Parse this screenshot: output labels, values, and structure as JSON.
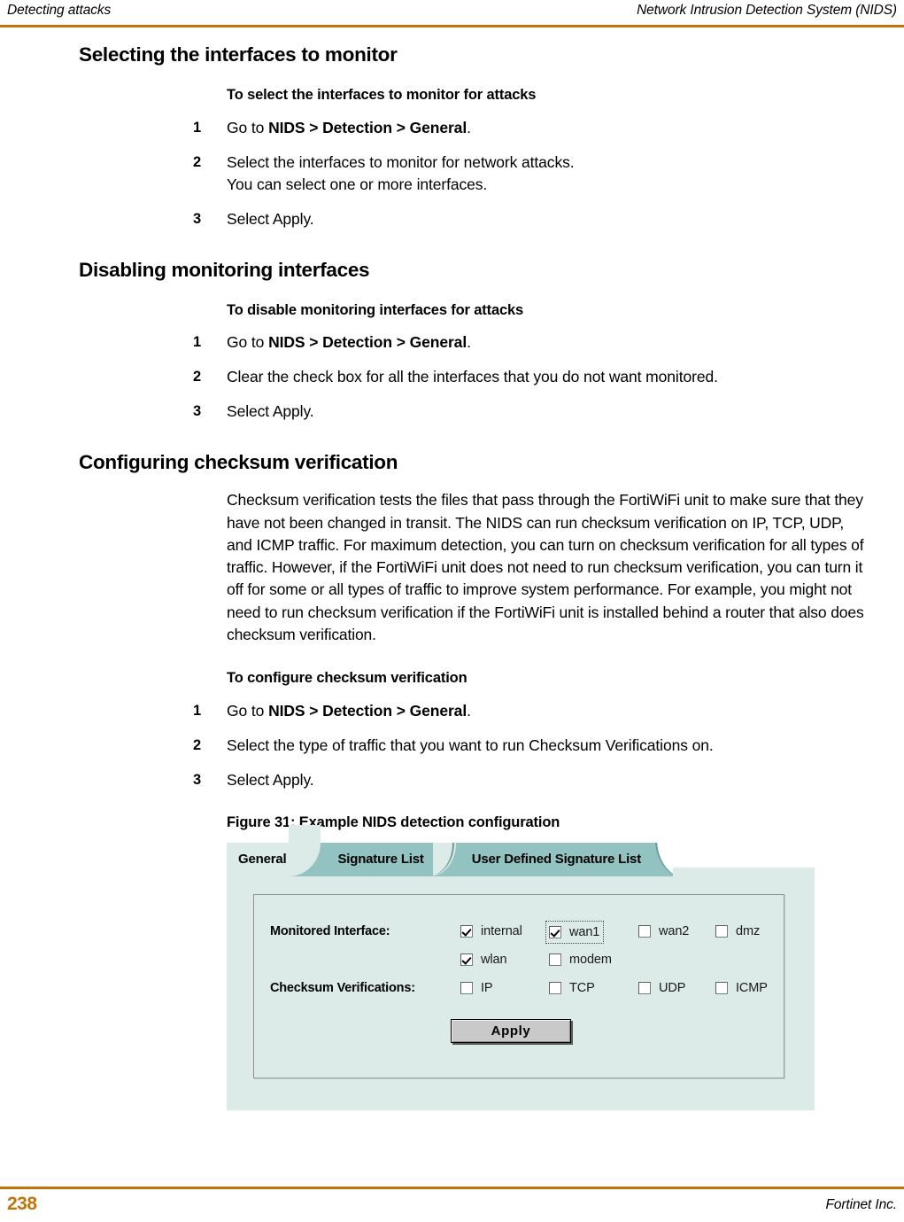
{
  "running_head": {
    "left": "Detecting attacks",
    "right": "Network Intrusion Detection System (NIDS)"
  },
  "sections": [
    {
      "heading": "Selecting the interfaces to monitor",
      "subheading": "To select the interfaces to monitor for attacks",
      "steps": [
        {
          "num": "1",
          "pre": "Go to ",
          "strong": "NIDS > Detection > General",
          "post": "."
        },
        {
          "num": "2",
          "pre": "Select the interfaces to monitor for network attacks.",
          "strong": "",
          "post": ""
        },
        {
          "num": "3",
          "pre": "Select Apply.",
          "strong": "",
          "post": ""
        }
      ],
      "step2_second_line": "You can select one or more interfaces."
    },
    {
      "heading": "Disabling monitoring interfaces",
      "subheading": "To disable monitoring interfaces for attacks",
      "steps": [
        {
          "num": "1",
          "pre": "Go to ",
          "strong": "NIDS > Detection > General",
          "post": "."
        },
        {
          "num": "2",
          "pre": "Clear the check box for all the interfaces that you do not want monitored.",
          "strong": "",
          "post": ""
        },
        {
          "num": "3",
          "pre": "Select Apply.",
          "strong": "",
          "post": ""
        }
      ]
    },
    {
      "heading": "Configuring checksum verification",
      "paragraph": "Checksum verification tests the files that pass through the FortiWiFi unit to make sure that they have not been changed in transit. The NIDS can run checksum verification on IP, TCP, UDP, and ICMP traffic. For maximum detection, you can turn on checksum verification for all types of traffic. However, if the FortiWiFi unit does not need to run checksum verification, you can turn it off for some or all types of traffic to improve system performance. For example, you might not need to run checksum verification if the FortiWiFi unit is installed behind a router that also does checksum verification.",
      "subheading": "To configure checksum verification",
      "steps": [
        {
          "num": "1",
          "pre": "Go to ",
          "strong": "NIDS > Detection > General",
          "post": "."
        },
        {
          "num": "2",
          "pre": "Select the type of traffic that you want to run Checksum Verifications on.",
          "strong": "",
          "post": ""
        },
        {
          "num": "3",
          "pre": "Select Apply.",
          "strong": "",
          "post": ""
        }
      ]
    }
  ],
  "figure": {
    "caption": "Figure 31: Example NIDS detection configuration",
    "tabs": [
      {
        "label": "General",
        "active": true
      },
      {
        "label": "Signature List",
        "active": false
      },
      {
        "label": "User Defined Signature List",
        "active": false
      }
    ],
    "fields": [
      {
        "label": "Monitored Interface:",
        "rows": [
          [
            {
              "label": "internal",
              "checked": true,
              "focused": false
            },
            {
              "label": "wan1",
              "checked": true,
              "focused": true
            },
            {
              "label": "wan2",
              "checked": false,
              "focused": false
            },
            {
              "label": "dmz",
              "checked": false,
              "focused": false
            }
          ],
          [
            {
              "label": "wlan",
              "checked": true,
              "focused": false
            },
            {
              "label": "modem",
              "checked": false,
              "focused": false
            }
          ]
        ]
      },
      {
        "label": "Checksum Verifications:",
        "rows": [
          [
            {
              "label": "IP",
              "checked": false,
              "focused": false
            },
            {
              "label": "TCP",
              "checked": false,
              "focused": false
            },
            {
              "label": "UDP",
              "checked": false,
              "focused": false
            },
            {
              "label": "ICMP",
              "checked": false,
              "focused": false
            }
          ]
        ]
      }
    ],
    "apply_label": "Apply"
  },
  "footer": {
    "page_number": "238",
    "right": "Fortinet Inc."
  },
  "colors": {
    "rule": "#c1740c",
    "page_number": "#c1740c",
    "tab_active": "#dcebe8",
    "tab_inactive": "#93c3c0",
    "panel": "#dcebe8",
    "button_face": "#c9c9c9"
  }
}
